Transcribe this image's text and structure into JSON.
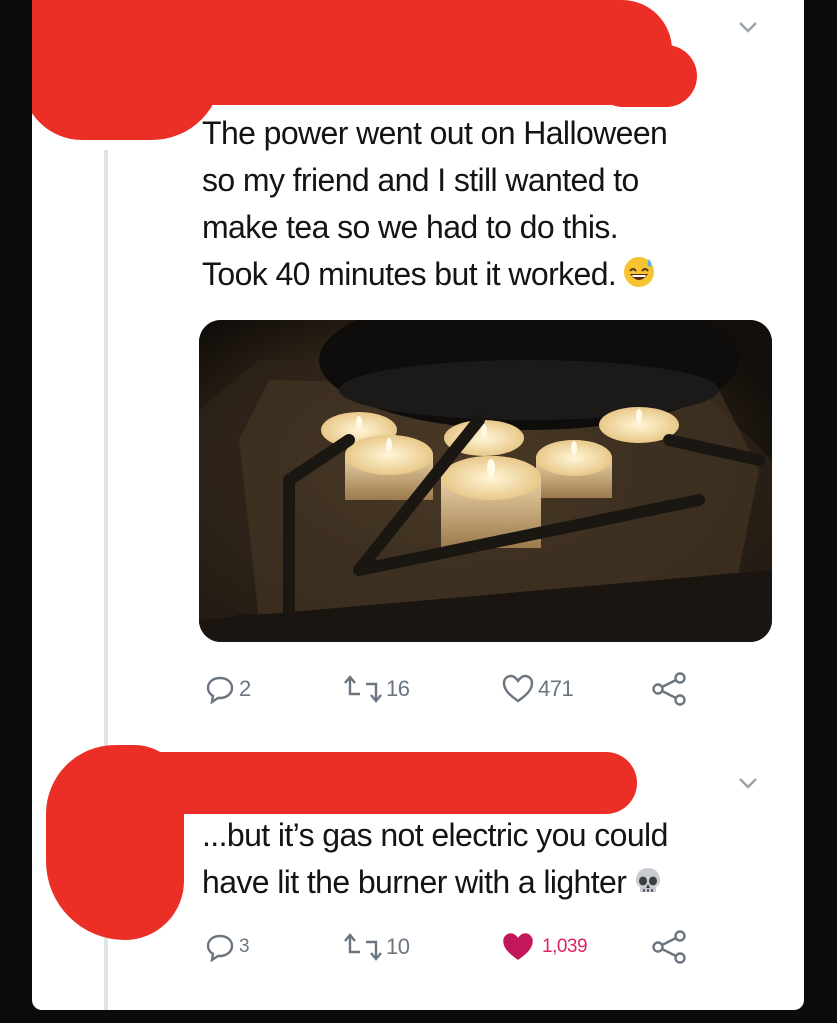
{
  "tweet1": {
    "text_lines": [
      "The power went out on Halloween",
      "so my friend and I still wanted to",
      "make tea so we had to do this.",
      "Took 40 minutes but it worked."
    ],
    "emoji": "grinning-sweat-emoji",
    "image_description": "tealight-candles-under-pot-on-gas-stove",
    "replies": "2",
    "retweets": "16",
    "likes": "471"
  },
  "tweet2": {
    "text_lines": [
      "...but it’s gas not electric you could",
      "have lit the burner with a lighter"
    ],
    "emoji": "skull-emoji",
    "replies": "3",
    "retweets": "10",
    "likes": "1,039",
    "liked": true
  },
  "colors": {
    "background": "#0b0b0c",
    "card": "#ffffff",
    "redaction": "#ec2f26",
    "text": "#141414",
    "action_gray": "#6b7580",
    "like_red": "#e0245e",
    "thread_line": "#dfe4e8"
  }
}
